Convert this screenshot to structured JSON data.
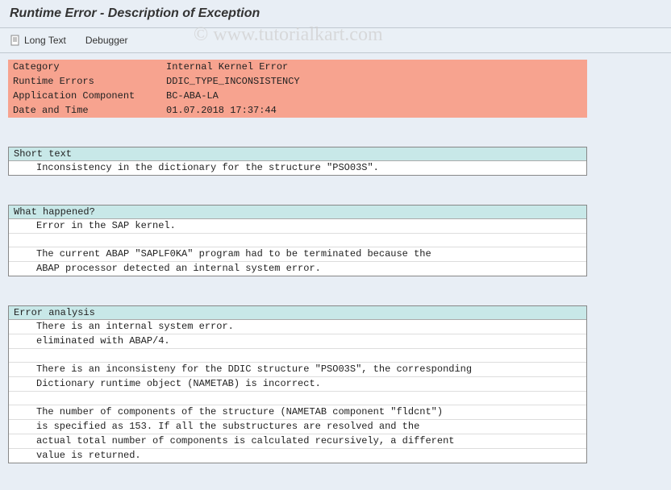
{
  "title": "Runtime Error - Description of Exception",
  "watermark": "© www.tutorialkart.com",
  "toolbar": {
    "long_text": "Long Text",
    "debugger": "Debugger"
  },
  "header": {
    "rows": [
      {
        "label": "Category",
        "value": "Internal Kernel Error"
      },
      {
        "label": "Runtime Errors",
        "value": "DDIC_TYPE_INCONSISTENCY"
      },
      {
        "label": "Application Component",
        "value": "BC-ABA-LA"
      },
      {
        "label": "Date and Time",
        "value": "01.07.2018 17:37:44"
      }
    ]
  },
  "sections": [
    {
      "title": "Short text",
      "lines": [
        "Inconsistency in the dictionary for the structure \"PSO03S\"."
      ]
    },
    {
      "title": "What happened?",
      "lines": [
        "Error in the SAP kernel.",
        "",
        "The current ABAP \"SAPLF0KA\" program had to be terminated because the",
        "ABAP processor detected an internal system error."
      ]
    },
    {
      "title": "Error analysis",
      "lines": [
        "There is an internal system error.",
        "eliminated with ABAP/4.",
        "",
        "There is an inconsisteny for the DDIC structure \"PSO03S\", the corresponding",
        "Dictionary runtime object (NAMETAB) is incorrect.",
        "",
        "The number of components of the structure (NAMETAB component \"fldcnt\")",
        "is specified as 153. If all the substructures are resolved and the",
        "actual total number of components is calculated recursively, a different",
        "value is returned."
      ]
    }
  ]
}
